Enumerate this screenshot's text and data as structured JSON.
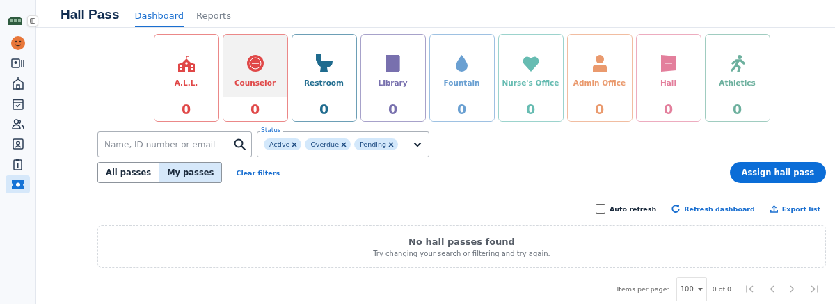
{
  "sidebar": {
    "items": [
      {
        "kind": "avatar",
        "selected": false
      },
      {
        "kind": "id-list",
        "selected": false
      },
      {
        "kind": "school",
        "selected": false
      },
      {
        "kind": "calendar",
        "selected": false
      },
      {
        "kind": "people",
        "selected": false
      },
      {
        "kind": "contact",
        "selected": false
      },
      {
        "kind": "badge",
        "selected": false
      },
      {
        "kind": "ticket",
        "selected": true
      }
    ]
  },
  "header": {
    "title": "Hall Pass",
    "tabs": [
      {
        "label": "Dashboard",
        "selected": true
      },
      {
        "label": "Reports",
        "selected": false
      }
    ]
  },
  "location_cards": [
    {
      "kind": "school",
      "label": "A.L.L.",
      "count": "0",
      "color": "#e04848",
      "selected": false
    },
    {
      "kind": "badge",
      "label": "Counselor",
      "count": "0",
      "color": "#e04848",
      "selected": true
    },
    {
      "kind": "toilet",
      "label": "Restroom",
      "count": "0",
      "color": "#1f6b8e",
      "selected": false
    },
    {
      "kind": "book",
      "label": "Library",
      "count": "0",
      "color": "#7870ae",
      "selected": false
    },
    {
      "kind": "drop",
      "label": "Fountain",
      "count": "0",
      "color": "#6aa0d2",
      "selected": false
    },
    {
      "kind": "heart",
      "label": "Nurse's Office",
      "count": "0",
      "color": "#67bcb2",
      "selected": false
    },
    {
      "kind": "person",
      "label": "Admin Office",
      "count": "0",
      "color": "#ea9a6e",
      "selected": false
    },
    {
      "kind": "flag",
      "label": "Hall",
      "count": "0",
      "color": "#e37f9c",
      "selected": false
    },
    {
      "kind": "runner",
      "label": "Athletics",
      "count": "0",
      "color": "#6db09e",
      "selected": false
    }
  ],
  "search": {
    "placeholder": "Name, ID number or email"
  },
  "status_filter": {
    "label": "Status",
    "chips": [
      "Active",
      "Overdue",
      "Pending"
    ]
  },
  "pass_toggle": [
    {
      "label": "All passes",
      "selected": false
    },
    {
      "label": "My passes",
      "selected": true
    }
  ],
  "clear_filters": "Clear filters",
  "assign_button": "Assign hall pass",
  "auto_refresh": {
    "label": "Auto refresh",
    "checked": false
  },
  "refresh_link": "Refresh dashboard",
  "export_link": "Export list",
  "empty_state": {
    "title": "No hall passes found",
    "message": "Try changing your search or filtering and try again."
  },
  "pagination": {
    "items_per_page_label": "Items per page:",
    "page_size": "100",
    "range": "0 of 0"
  }
}
